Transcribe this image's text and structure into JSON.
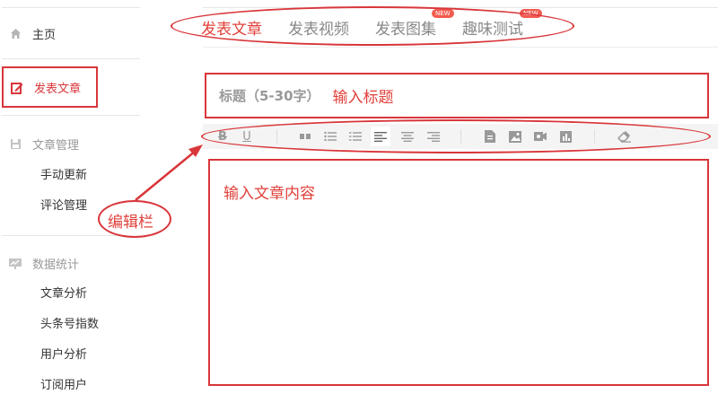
{
  "sidebar": {
    "home": "主页",
    "publish": "发表文章",
    "article_mgmt": {
      "label": "文章管理",
      "items": [
        "手动更新",
        "评论管理"
      ]
    },
    "stats": {
      "label": "数据统计",
      "items": [
        "文章分析",
        "头条号指数",
        "用户分析",
        "订阅用户"
      ]
    }
  },
  "tabs": [
    {
      "label": "发表文章",
      "active": true
    },
    {
      "label": "发表视频"
    },
    {
      "label": "发表图集",
      "badge": "NEW"
    },
    {
      "label": "趣味测试",
      "badge": "NEW"
    }
  ],
  "editor": {
    "title_label": "标题（5-30字）",
    "title_placeholder": "输入标题",
    "content_placeholder": "输入文章内容"
  },
  "toolbar": {
    "buttons": [
      "bold-icon",
      "underline-icon",
      "quote-icon",
      "bullet-list-icon",
      "numbered-list-icon",
      "align-left-icon",
      "align-center-icon",
      "align-right-icon",
      "document-icon",
      "image-icon",
      "video-icon",
      "chart-icon",
      "eraser-icon"
    ]
  },
  "annotation": {
    "label": "编辑栏"
  },
  "colors": {
    "accent": "#e0403a",
    "annotation": "#d8363a"
  }
}
